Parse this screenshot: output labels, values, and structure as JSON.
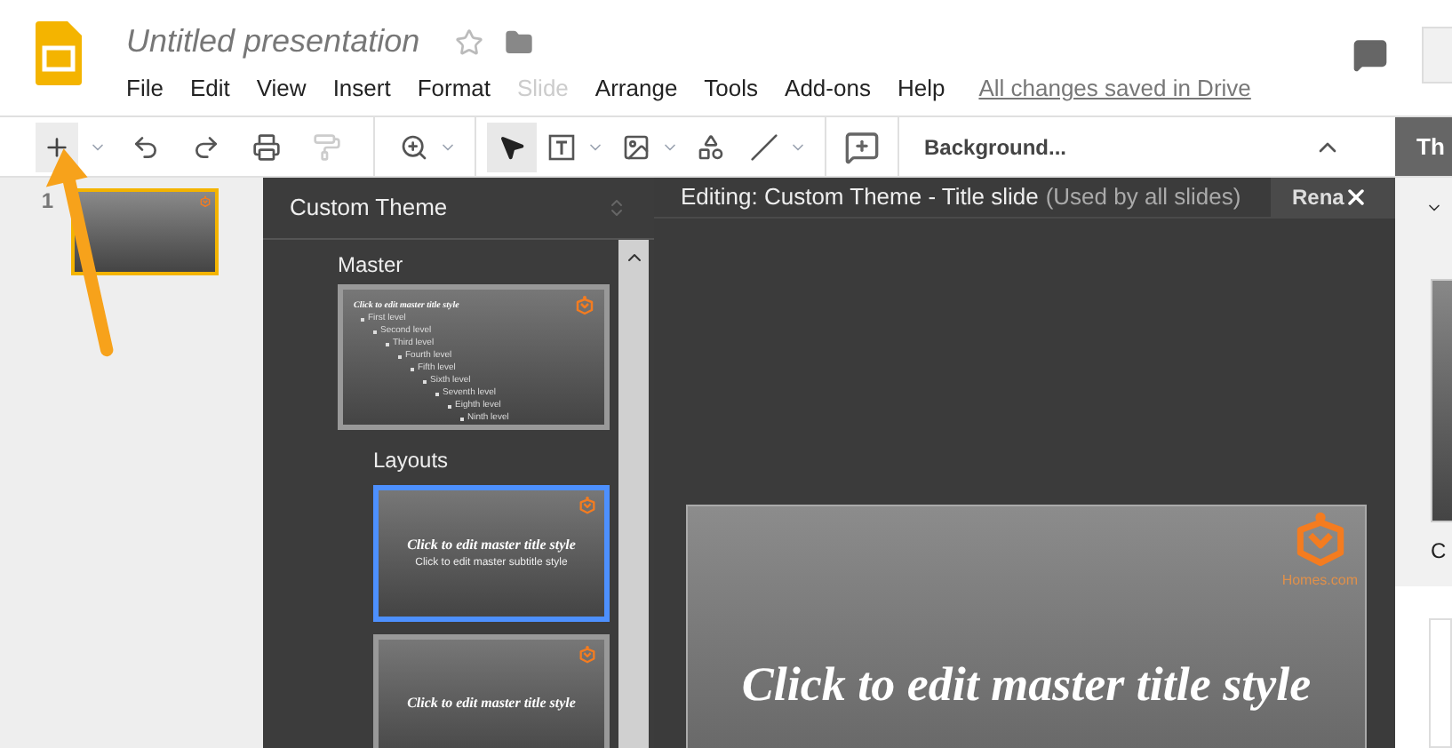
{
  "app": {
    "title": "Untitled presentation",
    "starred": false
  },
  "menu": [
    {
      "label": "File",
      "disabled": false
    },
    {
      "label": "Edit",
      "disabled": false
    },
    {
      "label": "View",
      "disabled": false
    },
    {
      "label": "Insert",
      "disabled": false
    },
    {
      "label": "Format",
      "disabled": false
    },
    {
      "label": "Slide",
      "disabled": true
    },
    {
      "label": "Arrange",
      "disabled": false
    },
    {
      "label": "Tools",
      "disabled": false
    },
    {
      "label": "Add-ons",
      "disabled": false
    },
    {
      "label": "Help",
      "disabled": false
    }
  ],
  "save_status": "All changes saved in Drive",
  "toolbar": {
    "background_button": "Background...",
    "right_tab": "Th"
  },
  "filmstrip": [
    {
      "number": "1",
      "selected": true
    }
  ],
  "theme_panel": {
    "title": "Custom Theme",
    "master_label": "Master",
    "master": {
      "title": "Click to edit master title style",
      "levels": [
        "First level",
        "Second level",
        "Third level",
        "Fourth level",
        "Fifth level",
        "Sixth level",
        "Seventh level",
        "Eighth level",
        "Ninth level"
      ]
    },
    "layouts_label": "Layouts",
    "layouts": [
      {
        "title": "Click to edit master title style",
        "subtitle": "Click to edit master subtitle style",
        "selected": true
      },
      {
        "title": "Click to edit master title style",
        "selected": false
      }
    ]
  },
  "editor": {
    "heading": "Editing: Custom Theme - Title slide",
    "note": "(Used by all slides)",
    "rename_button": "Rena",
    "slide_title": "Click to edit master title style",
    "logo_text": "Homes.com"
  },
  "right_panel": {
    "caption": "C"
  }
}
